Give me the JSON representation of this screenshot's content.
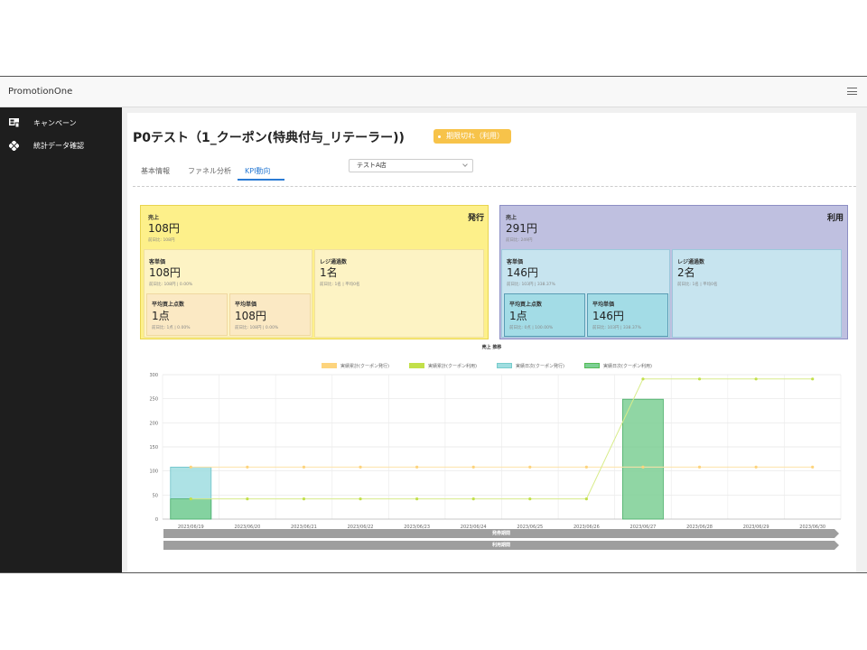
{
  "app": {
    "title": "PromotionOne"
  },
  "sidebar": {
    "items": [
      {
        "label": "キャンペーン",
        "icon": "campaign-icon"
      },
      {
        "label": "統計データ確認",
        "icon": "stats-icon"
      }
    ]
  },
  "page": {
    "title": "P0テスト（1_クーポン(特典付与_リテーラー))",
    "status_badge": "期限切れ（利用）"
  },
  "tabs": [
    {
      "label": "基本情報"
    },
    {
      "label": "ファネル分析"
    },
    {
      "label": "KPI動向"
    }
  ],
  "store_select": {
    "value": "テストA店"
  },
  "kpi": {
    "issue": {
      "kind": "発行",
      "sales": {
        "label": "売上",
        "value": "108円",
        "sub": "前日比: 108円"
      },
      "unit_price": {
        "label": "客単価",
        "value": "108円",
        "sub": "前日比: 108円 | 0.00%"
      },
      "register": {
        "label": "レジ通過数",
        "value": "1名",
        "sub": "前日比: 1名 | 平均0名"
      },
      "items_per": {
        "label": "平均買上点数",
        "value": "1点",
        "sub": "前日比: 1点 | 0.00%"
      },
      "avg_price": {
        "label": "平均単価",
        "value": "108円",
        "sub": "前日比: 108円 | 0.00%"
      }
    },
    "use": {
      "kind": "利用",
      "sales": {
        "label": "売上",
        "value": "291円",
        "sub": "前日比: 249円"
      },
      "unit_price": {
        "label": "客単価",
        "value": "146円",
        "sub": "前日比: 103円 | 338.37%"
      },
      "register": {
        "label": "レジ通過数",
        "value": "2名",
        "sub": "前日比: 1名 | 平均0名"
      },
      "items_per": {
        "label": "平均買上点数",
        "value": "1点",
        "sub": "前日比: 0点 | 100.00%"
      },
      "avg_price": {
        "label": "平均単価",
        "value": "146円",
        "sub": "前日比: 103円 | 338.37%"
      }
    }
  },
  "colors": {
    "issue_cum": "#fdd47d",
    "use_cum": "#c2e04a",
    "issue_daily": "#9fdde0",
    "use_daily": "#7ccf94",
    "issue_panel": "#fdf08a",
    "use_panel": "#bfc0e0"
  },
  "chart_data": {
    "type": "bar",
    "title": "売上 推移",
    "categories": [
      "2023/06/19",
      "2023/06/20",
      "2023/06/21",
      "2023/06/22",
      "2023/06/23",
      "2023/06/24",
      "2023/06/25",
      "2023/06/26",
      "2023/06/27",
      "2023/06/28",
      "2023/06/29",
      "2023/06/30"
    ],
    "ylim": [
      0,
      300
    ],
    "yticks": [
      0,
      50,
      100,
      150,
      200,
      250,
      300
    ],
    "series": [
      {
        "name": "実績累計(クーポン発行)",
        "kind": "line",
        "values": [
          108,
          108,
          108,
          108,
          108,
          108,
          108,
          108,
          108,
          108,
          108,
          108
        ]
      },
      {
        "name": "実績累計(クーポン利用)",
        "kind": "line",
        "values": [
          42,
          42,
          42,
          42,
          42,
          42,
          42,
          42,
          291,
          291,
          291,
          291
        ]
      },
      {
        "name": "実績日次(クーポン発行)",
        "kind": "bar",
        "values": [
          108,
          0,
          0,
          0,
          0,
          0,
          0,
          0,
          0,
          0,
          0,
          0
        ]
      },
      {
        "name": "実績日次(クーポン利用)",
        "kind": "bar",
        "values": [
          42,
          0,
          0,
          0,
          0,
          0,
          0,
          0,
          249,
          0,
          0,
          0
        ]
      }
    ],
    "legend_position": "top",
    "grid": true,
    "periods": [
      "発券期間",
      "利用期間"
    ]
  }
}
